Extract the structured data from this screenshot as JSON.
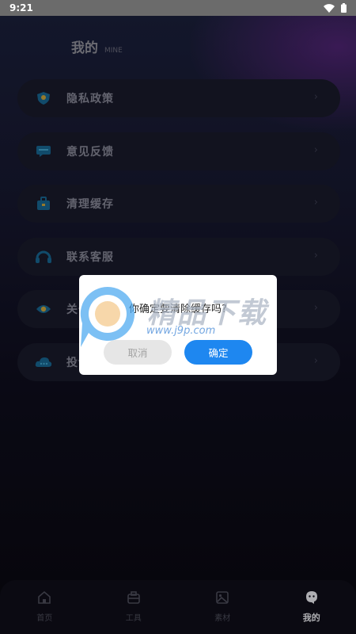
{
  "status_bar": {
    "time": "9:21"
  },
  "header": {
    "title": "我的",
    "subtitle": "MINE"
  },
  "menu": {
    "items": [
      {
        "label": "隐私政策",
        "icon": "shield-icon"
      },
      {
        "label": "意见反馈",
        "icon": "chat-icon"
      },
      {
        "label": "清理缓存",
        "icon": "toolbox-icon"
      },
      {
        "label": "联系客服",
        "icon": "headset-icon"
      },
      {
        "label": "关于我们",
        "icon": "eye-icon"
      },
      {
        "label": "投诉建议",
        "icon": "cloud-chat-icon"
      }
    ],
    "chevron": "›"
  },
  "dialog": {
    "message": "你确定要清除缓存吗?",
    "cancel_label": "取消",
    "confirm_label": "确定"
  },
  "watermark": {
    "text": "精品下载",
    "url": "www.j9p.com"
  },
  "tabbar": {
    "tabs": [
      {
        "label": "首页",
        "icon": "home-icon"
      },
      {
        "label": "工具",
        "icon": "briefcase-icon"
      },
      {
        "label": "素材",
        "icon": "image-icon"
      },
      {
        "label": "我的",
        "icon": "user-icon"
      }
    ]
  },
  "colors": {
    "accent": "#1e87f0",
    "menu_icon": "#1a6ea0"
  }
}
